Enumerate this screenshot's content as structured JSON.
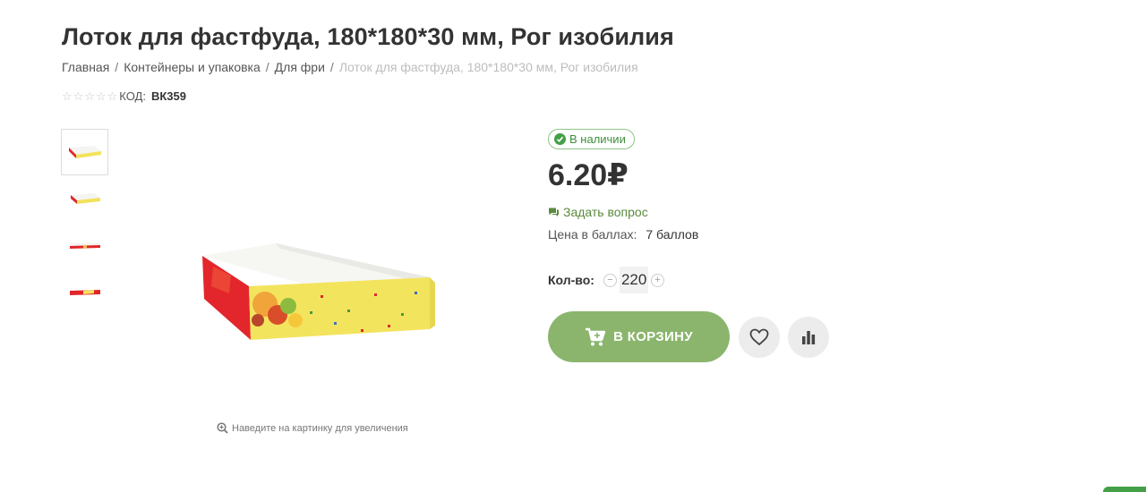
{
  "product": {
    "title": "Лоток для фастфуда, 180*180*30 мм, Рог изобилия",
    "code_label": "КОД:",
    "code_value": "ВК359",
    "rating": 0,
    "rating_max": 5
  },
  "breadcrumb": {
    "items": [
      "Главная",
      "Контейнеры и упаковка",
      "Для фри"
    ],
    "current": "Лоток для фастфуда, 180*180*30 мм, Рог изобилия",
    "separator": "/"
  },
  "gallery": {
    "thumbnail_count": 4,
    "zoom_hint": "Наведите на картинку для увеличения"
  },
  "purchase": {
    "stock_label": "В наличии",
    "price": "6.20₽",
    "ask_question": "Задать вопрос",
    "points_label": "Цена в баллах:",
    "points_value": "7 баллов",
    "quantity_label": "Кол-во:",
    "quantity_value": "220",
    "minus_symbol": "−",
    "plus_symbol": "+",
    "cart_button": "В КОРЗИНУ"
  },
  "icons": {
    "star": "star-outline-icon",
    "stock": "check-circle-icon",
    "ask": "chat-bubble-icon",
    "cart": "cart-icon",
    "wishlist": "heart-icon",
    "compare": "bar-chart-icon",
    "zoom": "zoom-in-icon"
  },
  "colors": {
    "accent_green": "#8bb56d",
    "stock_green": "#43a047",
    "ask_green": "#5a8a3c"
  }
}
